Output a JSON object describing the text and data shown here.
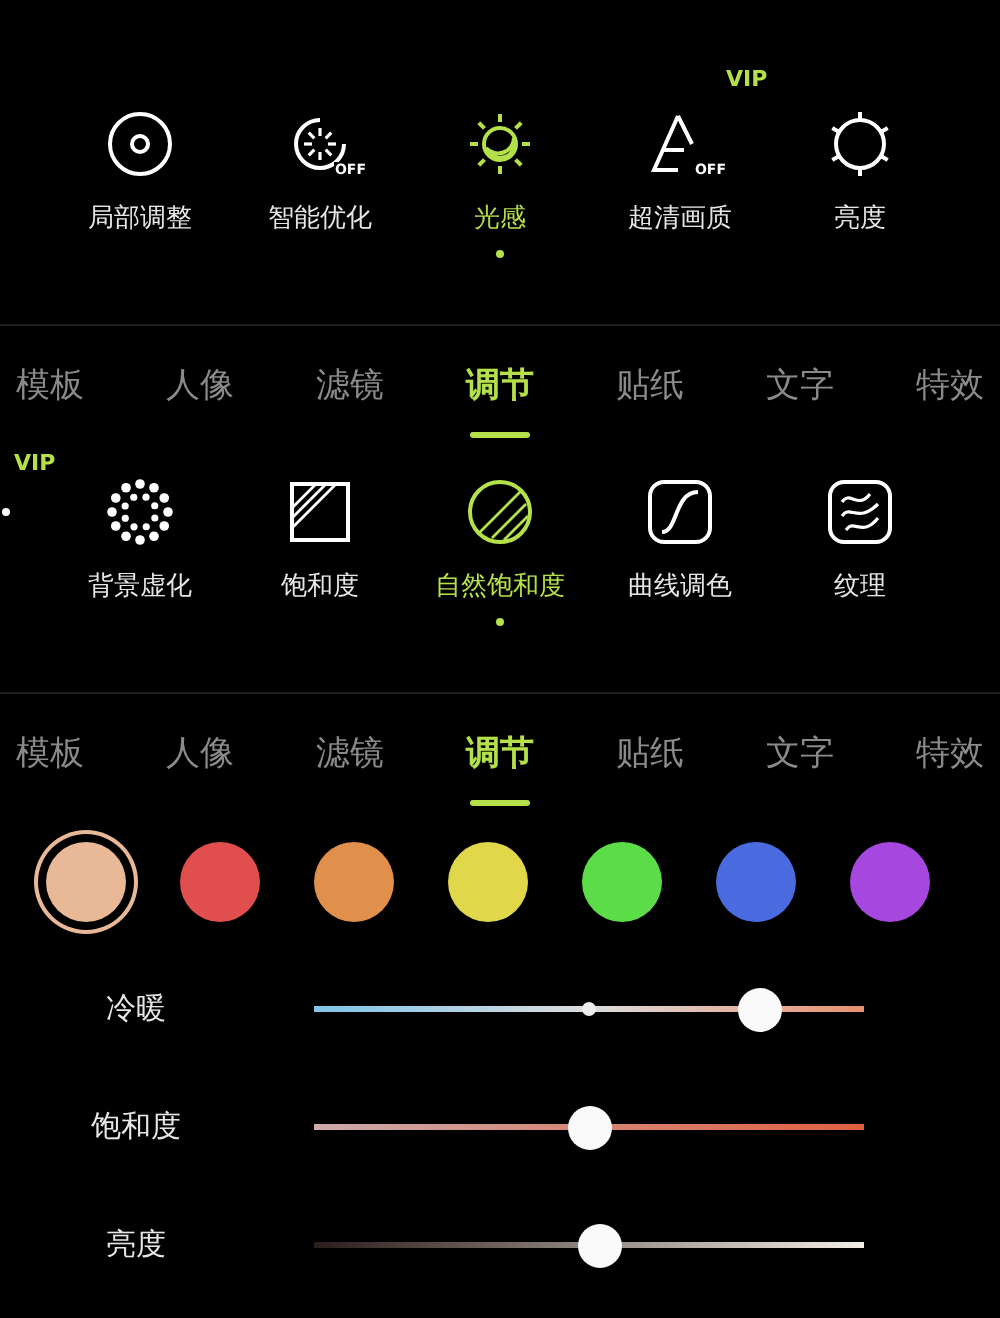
{
  "adjust_panel": {
    "tools": [
      {
        "label": "局部调整",
        "selected": false
      },
      {
        "label": "智能优化",
        "selected": false,
        "badge_off": "OFF"
      },
      {
        "label": "光感",
        "selected": true
      },
      {
        "label": "超清画质",
        "selected": false,
        "badge_off": "OFF",
        "vip": "VIP"
      },
      {
        "label": "亮度",
        "selected": false
      }
    ]
  },
  "edit_panel": {
    "tabs": [
      {
        "label": "模板",
        "selected": false
      },
      {
        "label": "人像",
        "selected": false
      },
      {
        "label": "滤镜",
        "selected": false
      },
      {
        "label": "调节",
        "selected": true
      },
      {
        "label": "贴纸",
        "selected": false
      },
      {
        "label": "文字",
        "selected": false
      },
      {
        "label": "特效",
        "selected": false
      }
    ],
    "tools": [
      {
        "vip": "VIP"
      },
      {
        "label": "背景虚化",
        "selected": false
      },
      {
        "label": "饱和度",
        "selected": false
      },
      {
        "label": "自然饱和度",
        "selected": true
      },
      {
        "label": "曲线调色",
        "selected": false
      },
      {
        "label": "纹理",
        "selected": false
      }
    ]
  },
  "color_panel": {
    "tabs": [
      {
        "label": "模板",
        "selected": false
      },
      {
        "label": "人像",
        "selected": false
      },
      {
        "label": "滤镜",
        "selected": false
      },
      {
        "label": "调节",
        "selected": true
      },
      {
        "label": "贴纸",
        "selected": false
      },
      {
        "label": "文字",
        "selected": false
      },
      {
        "label": "特效",
        "selected": false
      }
    ],
    "swatches": [
      {
        "color": "#e9b897",
        "selected": true
      },
      {
        "color": "#e04e4e",
        "selected": false
      },
      {
        "color": "#e0904a",
        "selected": false
      },
      {
        "color": "#e0d84a",
        "selected": false
      },
      {
        "color": "#5cdc48",
        "selected": false
      },
      {
        "color": "#4a6ae0",
        "selected": false
      },
      {
        "color": "#a648e0",
        "selected": false
      }
    ],
    "sliders": [
      {
        "label": "冷暖",
        "kind": "temperature",
        "level": 0.81
      },
      {
        "label": "饱和度",
        "kind": "saturation",
        "level": 0.5
      },
      {
        "label": "亮度",
        "kind": "brightness",
        "level": 0.52
      }
    ]
  }
}
